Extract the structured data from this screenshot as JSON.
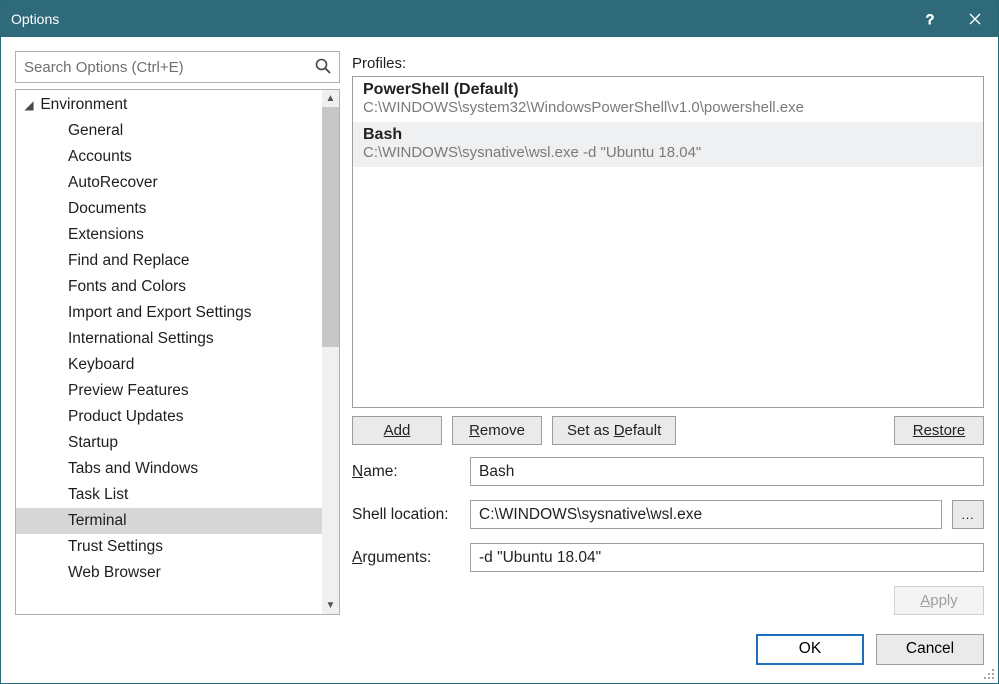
{
  "window": {
    "title": "Options"
  },
  "search": {
    "placeholder": "Search Options (Ctrl+E)"
  },
  "tree": {
    "root": "Environment",
    "items": [
      "General",
      "Accounts",
      "AutoRecover",
      "Documents",
      "Extensions",
      "Find and Replace",
      "Fonts and Colors",
      "Import and Export Settings",
      "International Settings",
      "Keyboard",
      "Preview Features",
      "Product Updates",
      "Startup",
      "Tabs and Windows",
      "Task List",
      "Terminal",
      "Trust Settings",
      "Web Browser"
    ],
    "selected": "Terminal"
  },
  "right": {
    "profiles_label": "Profiles:",
    "profiles": [
      {
        "name": "PowerShell (Default)",
        "path": "C:\\WINDOWS\\system32\\WindowsPowerShell\\v1.0\\powershell.exe"
      },
      {
        "name": "Bash",
        "path": "C:\\WINDOWS\\sysnative\\wsl.exe -d \"Ubuntu 18.04\""
      }
    ],
    "selected_profile": 1,
    "buttons": {
      "add": "Add",
      "remove": "Remove",
      "set_default": "Set as Default",
      "restore": "Restore"
    },
    "form": {
      "name_label": "Name:",
      "name_value": "Bash",
      "shell_label": "Shell location:",
      "shell_value": "C:\\WINDOWS\\sysnative\\wsl.exe",
      "browse": "...",
      "args_label": "Arguments:",
      "args_value": "-d \"Ubuntu 18.04\""
    },
    "apply": "Apply"
  },
  "footer": {
    "ok": "OK",
    "cancel": "Cancel"
  }
}
